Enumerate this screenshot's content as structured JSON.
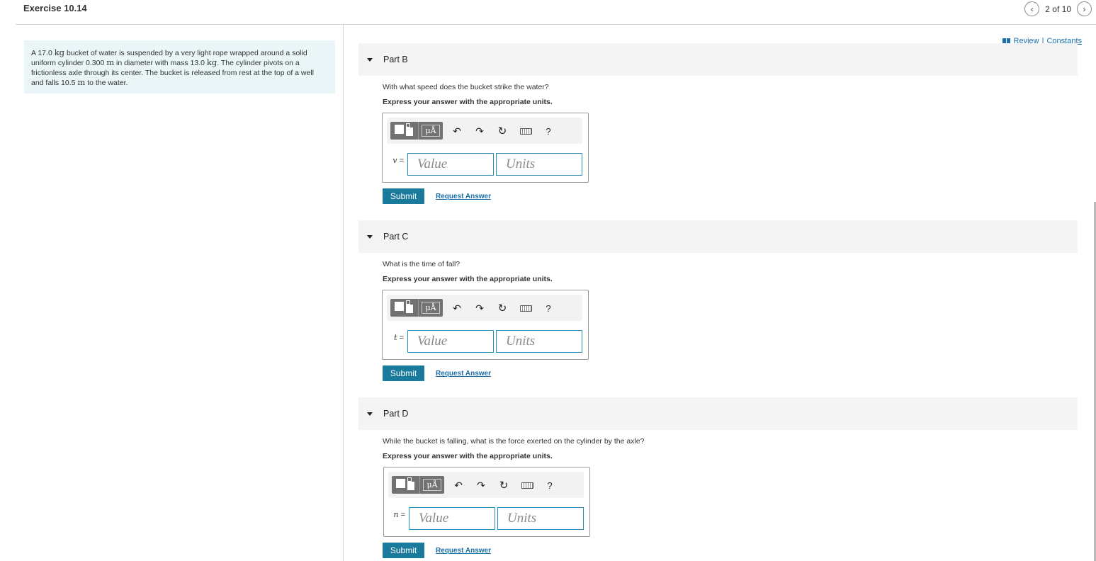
{
  "header": {
    "title": "Exercise 10.14",
    "prev_icon": "chevron-left-icon",
    "next_icon": "chevron-right-icon",
    "pager": "2 of 10"
  },
  "links": {
    "review": "Review",
    "separator": "|",
    "constants": "Constants"
  },
  "problem": {
    "t1": "A 17.0 ",
    "u1": "kg",
    "t2": " bucket of water is suspended by a very light rope wrapped around a solid uniform cylinder 0.300 ",
    "u2": "m",
    "t3": " in diameter with mass 13.0 ",
    "u3": "kg",
    "t4": ". The cylinder pivots on a frictionless axle through its center. The bucket is released from rest at the top of a well and falls 10.5 ",
    "u4": "m",
    "t5": " to the water."
  },
  "toolbar": {
    "units_symbol": "μÅ",
    "undo": "↶",
    "redo": "↷",
    "reset": "↻",
    "help": "?"
  },
  "parts": [
    {
      "label": "Part B",
      "question": "With what speed does the bucket strike the water?",
      "instruction": "Express your answer with the appropriate units.",
      "variable": "v",
      "equals": " =",
      "value_placeholder": "Value",
      "units_placeholder": "Units",
      "submit": "Submit",
      "request": "Request Answer"
    },
    {
      "label": "Part C",
      "question": "What is the time of fall?",
      "instruction": "Express your answer with the appropriate units.",
      "variable": "t",
      "equals": " =",
      "value_placeholder": "Value",
      "units_placeholder": "Units",
      "submit": "Submit",
      "request": "Request Answer"
    },
    {
      "label": "Part D",
      "question": "While the bucket is falling, what is the force exerted on the cylinder by the axle?",
      "instruction": "Express your answer with the appropriate units.",
      "variable": "n",
      "equals": " =",
      "value_placeholder": "Value",
      "units_placeholder": "Units",
      "submit": "Submit",
      "request": "Request Answer"
    }
  ]
}
